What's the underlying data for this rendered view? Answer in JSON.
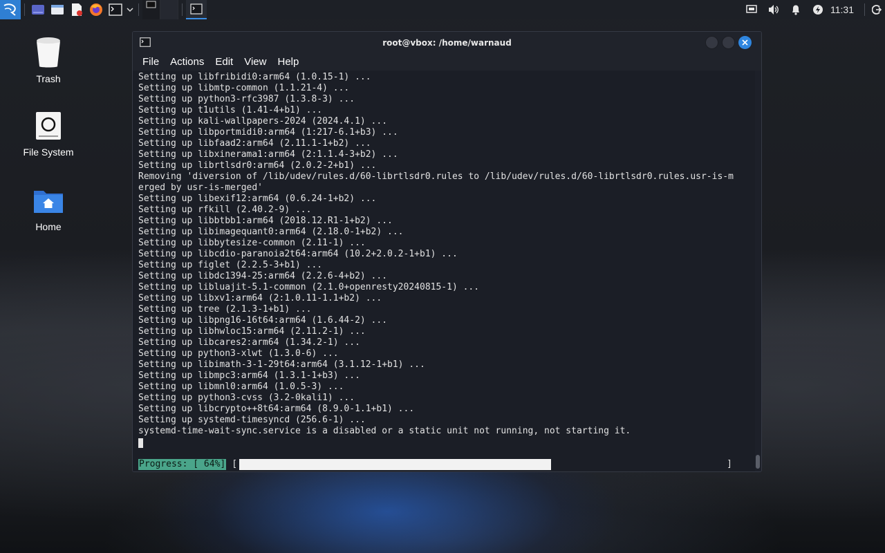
{
  "panel": {
    "clock": "11:31",
    "launchers": [
      "kali-menu-icon",
      "workspace-icon",
      "file-manager-icon",
      "text-editor-icon",
      "firefox-icon",
      "terminal-icon"
    ],
    "tray": [
      "network-icon",
      "volume-icon",
      "notifications-icon",
      "power-icon",
      "logout-icon"
    ]
  },
  "desktop": {
    "icons": [
      {
        "label": "Trash"
      },
      {
        "label": "File System"
      },
      {
        "label": "Home"
      }
    ]
  },
  "window": {
    "title": "root@vbox: /home/warnaud",
    "menu": [
      "File",
      "Actions",
      "Edit",
      "View",
      "Help"
    ]
  },
  "terminal": {
    "lines": [
      "Setting up libfribidi0:arm64 (1.0.15-1) ...",
      "Setting up libmtp-common (1.1.21-4) ...",
      "Setting up python3-rfc3987 (1.3.8-3) ...",
      "Setting up t1utils (1.41-4+b1) ...",
      "Setting up kali-wallpapers-2024 (2024.4.1) ...",
      "Setting up libportmidi0:arm64 (1:217-6.1+b3) ...",
      "Setting up libfaad2:arm64 (2.11.1-1+b2) ...",
      "Setting up libxinerama1:arm64 (2:1.1.4-3+b2) ...",
      "Setting up librtlsdr0:arm64 (2.0.2-2+b1) ...",
      "Removing 'diversion of /lib/udev/rules.d/60-librtlsdr0.rules to /lib/udev/rules.d/60-librtlsdr0.rules.usr-is-m",
      "erged by usr-is-merged'",
      "Setting up libexif12:arm64 (0.6.24-1+b2) ...",
      "Setting up rfkill (2.40.2-9) ...",
      "Setting up libbtbb1:arm64 (2018.12.R1-1+b2) ...",
      "Setting up libimagequant0:arm64 (2.18.0-1+b2) ...",
      "Setting up libbytesize-common (2.11-1) ...",
      "Setting up libcdio-paranoia2t64:arm64 (10.2+2.0.2-1+b1) ...",
      "Setting up figlet (2.2.5-3+b1) ...",
      "Setting up libdc1394-25:arm64 (2.2.6-4+b2) ...",
      "Setting up libluajit-5.1-common (2.1.0+openresty20240815-1) ...",
      "Setting up libxv1:arm64 (2:1.0.11-1.1+b2) ...",
      "Setting up tree (2.1.3-1+b1) ...",
      "Setting up libpng16-16t64:arm64 (1.6.44-2) ...",
      "Setting up libhwloc15:arm64 (2.11.2-1) ...",
      "Setting up libcares2:arm64 (1.34.2-1) ...",
      "Setting up python3-xlwt (1.3.0-6) ...",
      "Setting up libimath-3-1-29t64:arm64 (3.1.12-1+b1) ...",
      "Setting up libmpc3:arm64 (1.3.1-1+b3) ...",
      "Setting up libmnl0:arm64 (1.0.5-3) ...",
      "Setting up python3-cvss (3.2-0kali1) ...",
      "Setting up libcrypto++8t64:arm64 (8.9.0-1.1+b1) ...",
      "Setting up systemd-timesyncd (256.6-1) ...",
      "systemd-time-wait-sync.service is a disabled or a static unit not running, not starting it."
    ],
    "progress_label": "Progress: [ 64%]",
    "progress_open": "[",
    "progress_close": "]",
    "progress_fraction": 0.64
  },
  "colors": {
    "accent": "#2f86e0",
    "progress_label_bg": "#4aa58a"
  }
}
